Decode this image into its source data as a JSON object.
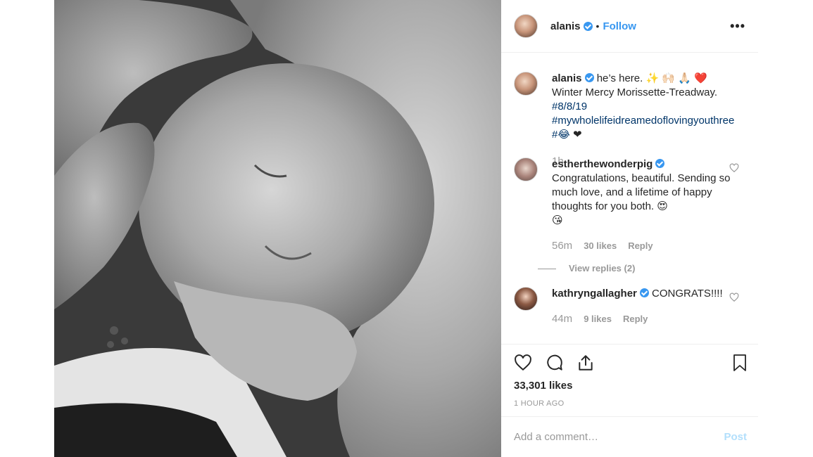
{
  "post": {
    "image_description_icon": "baby-photo",
    "author": "alanis",
    "follow_label": "Follow",
    "dot": "•",
    "more_label": "•••"
  },
  "caption": {
    "username": "alanis",
    "text_before": "he’s here. ✨ 🙌🏻 🙏🏻 ❤️  Winter Mercy Morissette-Treadway. ",
    "hashtag1": "#8/8/19",
    "hashtag2": "#mywholelifeidreamedoflovingyouthree",
    "hashtag3": "#😂",
    "text_after": " ❤",
    "time": "1h"
  },
  "comments": [
    {
      "username": "estherthewonderpig",
      "text": "Congratulations, beautiful. Sending so much love, and a lifetime of happy thoughts for you both. 😍",
      "text_line2": "😘",
      "time": "56m",
      "likes": "30 likes",
      "reply": "Reply",
      "view_replies": "View replies (2)"
    },
    {
      "username": "kathryngallagher",
      "text": "CONGRATS!!!!",
      "time": "44m",
      "likes": "9 likes",
      "reply": "Reply"
    }
  ],
  "footer": {
    "likes_total": "33,301 likes",
    "time_ago": "1 HOUR AGO",
    "comment_placeholder": "Add a comment…",
    "post_label": "Post"
  },
  "colors": {
    "link": "#3897f0",
    "hashtag": "#003569",
    "muted": "#999999",
    "post_disabled": "#b2dffc"
  }
}
